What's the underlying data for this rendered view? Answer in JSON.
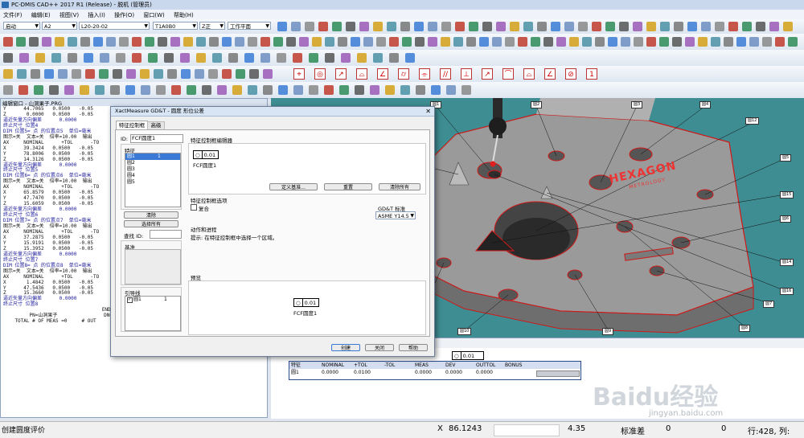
{
  "window": {
    "title": "PC-DMIS CAD++ 2017 R1 (Release) - 脱机 (管理员)"
  },
  "menu": [
    "文件(F)",
    "编辑(E)",
    "视图(V)",
    "插入(I)",
    "操作(O)",
    "窗口(W)",
    "帮助(H)"
  ],
  "toolbar": {
    "combos": [
      "启动",
      "A2",
      "L20-20-02",
      "T1A0B0",
      "Z正",
      "工作平面"
    ],
    "tolerance_glyphs": [
      "⌖",
      "◎",
      "↗",
      "⌓",
      "∠",
      "⌭",
      "⌯",
      "//",
      "⊥",
      "↗",
      "⌒",
      "⌓",
      "∠",
      "⊘",
      "1"
    ]
  },
  "report": {
    "title": "编辑窗口 - 山洞果子.PRG",
    "lines": [
      "Y      44.7065   0.0500   -0.05",
      "Z       0.0000   0.0500   -0.05",
      "逼近矢量方向偏差      0.0000",
      "终止尺寸 位置4",
      "DIM 位置5= 点 的位置点5  单位=毫米",
      "图示=关  文本=关  倍率=10.00  输出",
      "AX     NOMINAL      +TOL      -TO",
      "X      39.3424   0.0500   -0.05",
      "Y      78.8006   0.0500   -0.05",
      "Z      14.3126   0.0500   -0.05",
      "逼近矢量方向偏差      0.0000",
      "终止尺寸 位置5",
      "DIM 位置6= 点 的位置点6  单位=毫米",
      "图示=关  文本=关  倍率=10.00  输出",
      "AX     NOMINAL      +TOL      -TO",
      "X      65.8579   0.0500   -0.05",
      "Y      47.7470   0.0500   -0.05",
      "Z      15.6059   0.0500   -0.05",
      "逼近矢量方向偏差      0.0000",
      "终止尺寸 位置6",
      "DIM 位置7= 点 的位置点7  单位=毫米",
      "图示=关  文本=关  倍率=10.00  输出",
      "AX     NOMINAL      +TOL      -TO",
      "X      37.2875   0.0500   -0.05",
      "Y      15.9191   0.0500   -0.05",
      "Z      15.3952   0.0500   -0.05",
      "逼近矢量方向偏差      0.0000",
      "终止尺寸 位置7",
      "DIM 位置8= 点 的位置点8  单位=毫米",
      "图示=关  文本=关  倍率=10.00  输出",
      "AX     NOMINAL      +TOL      -TO",
      "X       1.4842   0.0500   -0.05",
      "Y      47.5436   0.0500   -0.05",
      "Z      15.3660   0.0500   -0.05",
      "逼近矢量方向偏差      0.0000",
      "终止尺寸 位置8",
      "",
      "                                  END O",
      "         PN=山洞果子                DNG",
      "    TOTAL # OF MEAS =0     # OUT"
    ]
  },
  "dialog": {
    "title": "XactMeasure GD&T - 圆度 形位公差",
    "tabs": [
      "特征控制框",
      "高级"
    ],
    "id_label": "ID:",
    "id_value": "FCF圆度1",
    "features_label": "特征",
    "features": [
      "圆1",
      "圆2",
      "圆3",
      "圆4",
      "圆5"
    ],
    "feature_count": "1",
    "clear_btn": "清除",
    "select_all_btn": "选择所有",
    "find_id_label": "查找 ID:",
    "datum_label": "基准",
    "leader_label": "引导线",
    "leader_item": "圆1",
    "leader_count": "1",
    "editor_label": "特征控制框编辑器",
    "fcf_symbol": "○",
    "fcf_value": "0.01",
    "fcf_name": "FCF圆度1",
    "define_datum_btn": "定义基准...",
    "reset_btn": "重置",
    "clear_all_btn": "清除所有",
    "options_label": "特征控制框选项",
    "compound_label": "复合",
    "gdt_std_label": "GD&T 标准",
    "gdt_std_value": "ASME Y14.5",
    "actions_label": "动作和进程",
    "hint": "提示: 在特征控制框中选择一个区域。",
    "preview_label": "预览",
    "create_btn": "创建",
    "close_btn": "关闭",
    "help_btn": "帮助"
  },
  "viewport": {
    "logo": "HEXAGON",
    "logo_sub": "METROLOGY",
    "labels": [
      "圆1",
      "圆2",
      "圆3",
      "圆4",
      "圆5",
      "圆6",
      "圆7",
      "圆8",
      "圆9",
      "圆10",
      "圆11",
      "圆12",
      "圆13",
      "圆14",
      "圆15",
      "圆16"
    ]
  },
  "results": {
    "fcf_symbol": "○",
    "fcf_value": "0.01",
    "headers": [
      "特征",
      "NOMINAL",
      "+TOL",
      "-TOL",
      "MEAS",
      "DEV",
      "OUTTOL",
      "BONUS"
    ],
    "row": [
      "圆1",
      "0.0000",
      "0.0100",
      "",
      "0.0000",
      "0.0000",
      "0.0000",
      ""
    ]
  },
  "status": {
    "message": "创建圆度评价",
    "x_label": "X",
    "x_value": "86.1243",
    "val2": "4.35",
    "std_label": "标准差",
    "std_value": "0",
    "zero": "0",
    "rowcol": "行:428, 列:"
  },
  "watermark": {
    "brand": "Baidu经验",
    "url": "jingyan.baidu.com"
  },
  "colors": {
    "viewport": "#3e8d92",
    "part_red": "#d01818",
    "accent": "#2b6cb0"
  }
}
